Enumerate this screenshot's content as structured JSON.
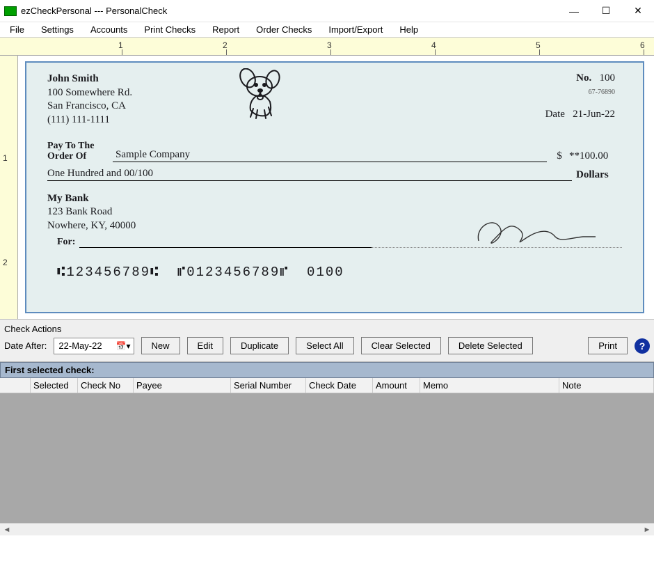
{
  "window": {
    "title": "ezCheckPersonal --- PersonalCheck"
  },
  "menu": {
    "items": [
      "File",
      "Settings",
      "Accounts",
      "Print Checks",
      "Report",
      "Order Checks",
      "Import/Export",
      "Help"
    ]
  },
  "ruler": {
    "labels": [
      "1",
      "2",
      "3",
      "4",
      "5",
      "6"
    ]
  },
  "vruler": {
    "labels": [
      "1",
      "2"
    ]
  },
  "check": {
    "payer": {
      "name": "John Smith",
      "addr1": "100 Somewhere Rd.",
      "addr2": "San Francisco, CA",
      "phone": "(111) 111-1111"
    },
    "number_label": "No.",
    "number": "100",
    "routing_small": "67-76890",
    "date_label": "Date",
    "date": "21-Jun-22",
    "pay_label1": "Pay To The",
    "pay_label2": "Order Of",
    "payee": "Sample Company",
    "amount": "**100.00",
    "amount_words": "One Hundred  and 00/100",
    "dollars_label": "Dollars",
    "dollar_sign": "$",
    "bank": {
      "name": "My Bank",
      "addr1": "123 Bank Road",
      "addr2": "Nowhere, KY, 40000"
    },
    "for_label": "For:",
    "micr": "⑆123456789⑆  ⑈0123456789⑈  0100"
  },
  "actions": {
    "section_title": "Check Actions",
    "date_after_label": "Date After:",
    "date_after_value": "22-May-22",
    "buttons": {
      "new": "New",
      "edit": "Edit",
      "duplicate": "Duplicate",
      "select_all": "Select All",
      "clear_selected": "Clear Selected",
      "delete_selected": "Delete Selected",
      "print": "Print"
    },
    "help": "?"
  },
  "grid": {
    "header1": "First selected check:",
    "columns": [
      "",
      "Selected",
      "Check No",
      "Payee",
      "Serial Number",
      "Check Date",
      "Amount",
      "Memo",
      "Note"
    ]
  }
}
